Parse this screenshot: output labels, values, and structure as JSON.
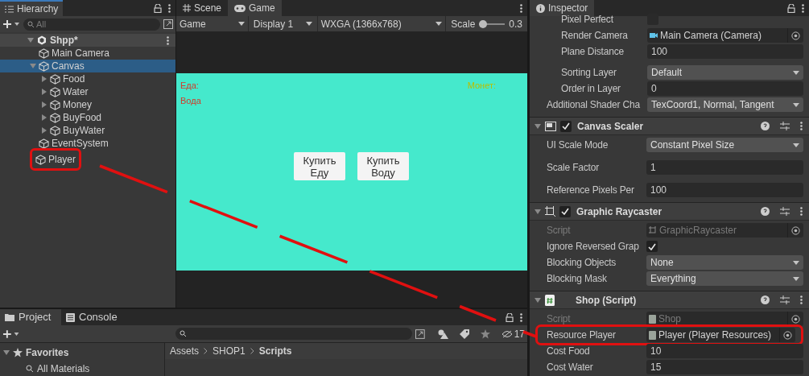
{
  "hierarchy": {
    "title": "Hierarchy",
    "search": {
      "placeholder": "All"
    },
    "scene": {
      "name": "Shpp*",
      "children": [
        {
          "name": "Main Camera",
          "selected": false,
          "highlighted": false
        },
        {
          "name": "Canvas",
          "selected": true,
          "highlighted": false,
          "expanded": true,
          "children": [
            {
              "name": "Food",
              "selected": false,
              "highlighted": false,
              "expanded": false
            },
            {
              "name": "Water",
              "selected": false,
              "highlighted": false,
              "expanded": false
            },
            {
              "name": "Money",
              "selected": false,
              "highlighted": false,
              "expanded": false
            },
            {
              "name": "BuyFood",
              "selected": false,
              "highlighted": false,
              "expanded": false
            },
            {
              "name": "BuyWater",
              "selected": false,
              "highlighted": false,
              "expanded": false
            }
          ]
        },
        {
          "name": "EventSystem",
          "selected": false,
          "highlighted": false
        },
        {
          "name": "Player",
          "selected": false,
          "highlighted": true
        }
      ]
    }
  },
  "game": {
    "tabs": [
      {
        "label": "Scene",
        "kind": "scene",
        "selected": false
      },
      {
        "label": "Game",
        "kind": "game",
        "selected": true
      }
    ],
    "toolbar": {
      "mode": "Game",
      "display": "Display 1",
      "resolution": "WXGA (1366x768)",
      "scale_label": "Scale",
      "scale_value": "0.3",
      "level": 0
    },
    "labels": [
      {
        "text": "Еда:",
        "color": "#d23a2a"
      },
      {
        "text": "Вода",
        "color": "#d23a2a"
      },
      {
        "text": "Монет:",
        "color": "#b8c000"
      }
    ],
    "buttons": [
      "Купить Еду",
      "Купить Воду"
    ]
  },
  "project": {
    "tabs": [
      {
        "label": "Project",
        "kind": "folder",
        "selected": true
      },
      {
        "label": "Console",
        "kind": "console",
        "selected": false
      }
    ],
    "hidden_count": "17",
    "favorites": {
      "label": "Favorites",
      "items": [
        "All Materials"
      ]
    },
    "breadcrumb": [
      "Assets",
      "SHOP1",
      "Scripts"
    ]
  },
  "inspector": {
    "title": "Inspector",
    "rows": [
      {
        "label": "Pixel Perfect",
        "kind": "checkbox",
        "checked": false
      },
      {
        "label": "Render Camera",
        "kind": "object",
        "value": "Main Camera (Camera)"
      },
      {
        "label": "Plane Distance",
        "kind": "text",
        "value": "100"
      },
      {
        "label": "Sorting Layer",
        "kind": "dropdown",
        "value": "Default"
      },
      {
        "label": "Order in Layer",
        "kind": "text",
        "value": "0"
      },
      {
        "label": "Additional Shader Cha",
        "kind": "dropdown",
        "value": "TexCoord1, Normal, Tangent"
      }
    ],
    "components": [
      {
        "title": "Canvas Scaler",
        "enabled": true,
        "rows": [
          {
            "label": "UI Scale Mode",
            "kind": "dropdown",
            "value": "Constant Pixel Size",
            "disabled": false,
            "highlighted": false
          },
          {
            "label": "Scale Factor",
            "kind": "text",
            "value": "1",
            "disabled": false,
            "highlighted": false
          },
          {
            "label": "Reference Pixels Per",
            "kind": "text",
            "value": "100",
            "disabled": false,
            "highlighted": false
          }
        ]
      },
      {
        "title": "Graphic Raycaster",
        "enabled": true,
        "rows": [
          {
            "label": "Script",
            "kind": "object",
            "value": "GraphicRaycaster",
            "disabled": true,
            "highlighted": false
          },
          {
            "label": "Ignore Reversed Grap",
            "kind": "checkbox",
            "checked": true,
            "disabled": false,
            "highlighted": false
          },
          {
            "label": "Blocking Objects",
            "kind": "dropdown",
            "value": "None",
            "disabled": false,
            "highlighted": false
          },
          {
            "label": "Blocking Mask",
            "kind": "dropdown",
            "value": "Everything",
            "disabled": false,
            "highlighted": false
          }
        ]
      },
      {
        "title": "Shop (Script)",
        "rows": [
          {
            "label": "Script",
            "kind": "object",
            "value": "Shop",
            "disabled": true,
            "highlighted": false
          },
          {
            "label": "Resource Player",
            "kind": "object",
            "value": "Player (Player Resources)",
            "disabled": false,
            "highlighted": true
          },
          {
            "label": "Cost Food",
            "kind": "text",
            "value": "10",
            "disabled": false,
            "highlighted": false
          },
          {
            "label": "Cost Water",
            "kind": "text",
            "value": "15",
            "disabled": false,
            "highlighted": false
          }
        ]
      }
    ]
  }
}
